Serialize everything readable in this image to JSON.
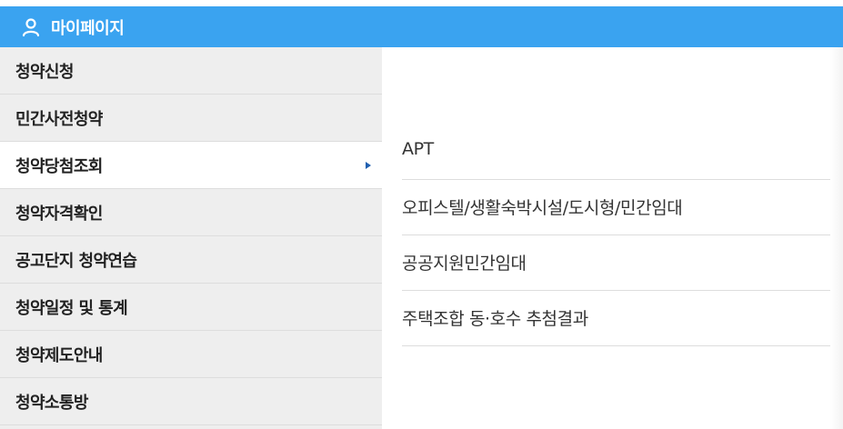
{
  "header": {
    "title": "마이페이지",
    "icon": "user-icon",
    "color": "#3aa3f0"
  },
  "sidebar": {
    "items": [
      {
        "label": "청약신청"
      },
      {
        "label": "민간사전청약"
      },
      {
        "label": "청약당첨조회",
        "active": true
      },
      {
        "label": "청약자격확인"
      },
      {
        "label": "공고단지 청약연습"
      },
      {
        "label": "청약일정 및 통계"
      },
      {
        "label": "청약제도안내"
      },
      {
        "label": "청약소통방"
      }
    ],
    "active_arrow_icon": "triangle-right-icon",
    "active_arrow_color": "#1f5fb0"
  },
  "submenu": {
    "items": [
      {
        "label": "APT"
      },
      {
        "label": "오피스텔/생활숙박시설/도시형/민간임대"
      },
      {
        "label": "공공지원민간임대"
      },
      {
        "label": "주택조합 동·호수 추첨결과"
      }
    ]
  }
}
